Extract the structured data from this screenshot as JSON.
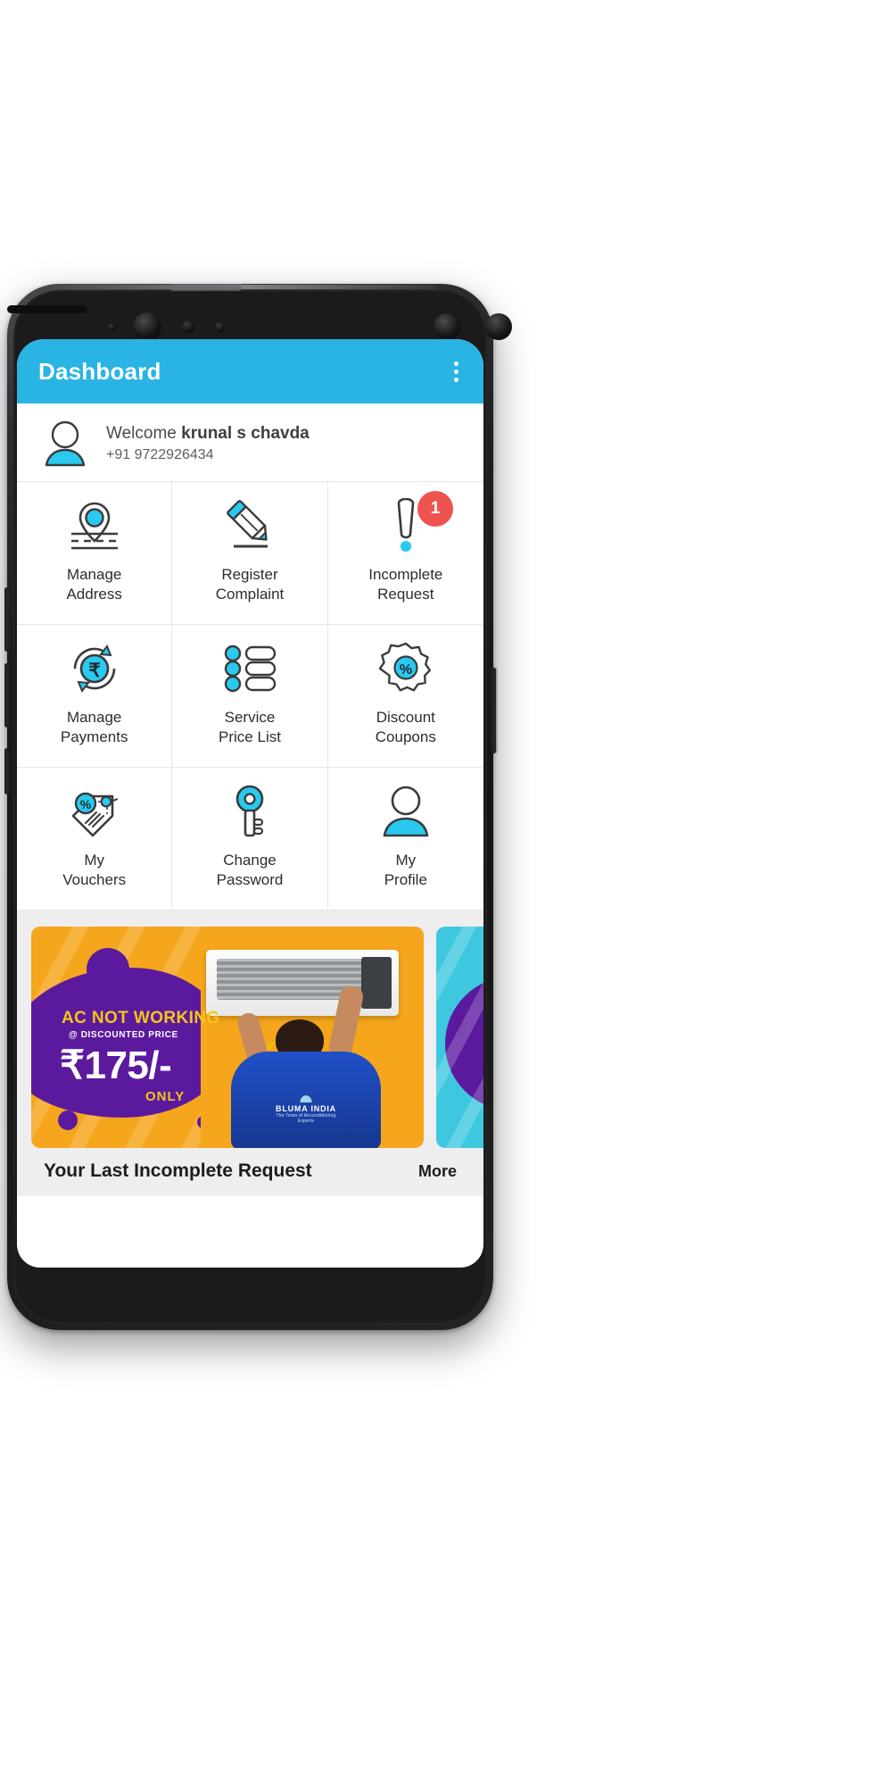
{
  "app": {
    "title": "Dashboard",
    "overflow_menu_icon": "kebab-menu-icon",
    "accent_color": "#29b4e3",
    "badge_color": "#ef5350"
  },
  "profile": {
    "avatar_icon": "user-avatar-icon",
    "welcome_prefix": "Welcome ",
    "user_name": "krunal s chavda",
    "phone": "+91 9722926434"
  },
  "grid": {
    "tiles": [
      {
        "icon": "map-pin-location-icon",
        "line1": "Manage",
        "line2": "Address"
      },
      {
        "icon": "pencil-edit-icon",
        "line1": "Register",
        "line2": "Complaint"
      },
      {
        "icon": "exclamation-alert-icon",
        "line1": "Incomplete",
        "line2": "Request",
        "badge": "1"
      },
      {
        "icon": "rupee-refresh-icon",
        "line1": "Manage",
        "line2": "Payments"
      },
      {
        "icon": "bullet-list-icon",
        "line1": "Service",
        "line2": "Price List"
      },
      {
        "icon": "discount-seal-icon",
        "line1": "Discount",
        "line2": "Coupons"
      },
      {
        "icon": "price-tag-percent-icon",
        "line1": "My",
        "line2": "Vouchers"
      },
      {
        "icon": "key-icon",
        "line1": "Change",
        "line2": "Password"
      },
      {
        "icon": "user-profile-icon",
        "line1": "My",
        "line2": "Profile"
      }
    ]
  },
  "banner": {
    "headline_plain": "AC NOT ",
    "headline_accent": "WORKING",
    "subline": "@ DISCOUNTED PRICE",
    "price": "₹175/-",
    "only": "ONLY",
    "brand_name": "BLUMA INDIA",
    "brand_tagline": "The Team of Airconditioning Experts"
  },
  "footer": {
    "title": "Your Last Incomplete Request",
    "more": "More"
  }
}
